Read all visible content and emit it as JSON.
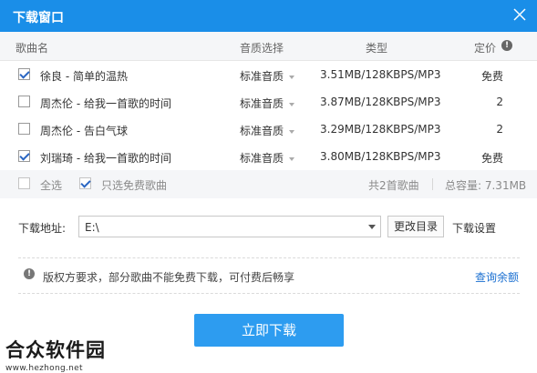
{
  "window": {
    "title": "下载窗口"
  },
  "table": {
    "headers": {
      "name": "歌曲名",
      "quality": "音质选择",
      "type": "类型",
      "price": "定价"
    },
    "rows": [
      {
        "checked": true,
        "name": "徐良 - 简单的温热",
        "quality": "标准音质",
        "type": "3.51MB/128KBPS/MP3",
        "price": "免费"
      },
      {
        "checked": false,
        "name": "周杰伦 - 给我一首歌的时间",
        "quality": "标准音质",
        "type": "3.87MB/128KBPS/MP3",
        "price": "2"
      },
      {
        "checked": false,
        "name": "周杰伦 - 告白气球",
        "quality": "标准音质",
        "type": "3.29MB/128KBPS/MP3",
        "price": "2"
      },
      {
        "checked": true,
        "name": "刘瑞琦 - 给我一首歌的时间",
        "quality": "标准音质",
        "type": "3.80MB/128KBPS/MP3",
        "price": "免费"
      }
    ]
  },
  "footer": {
    "select_all": "全选",
    "select_all_checked": false,
    "only_free": "只选免费歌曲",
    "only_free_checked": true,
    "count": "共2首歌曲",
    "capacity": "总容量: 7.31MB"
  },
  "address": {
    "label": "下载地址:",
    "value": "E:\\",
    "change_button": "更改目录",
    "settings": "下载设置"
  },
  "notice": {
    "text": "版权方要求，部分歌曲不能免费下载，可付费后畅享",
    "link": "查询余额"
  },
  "actions": {
    "download": "立即下载"
  },
  "watermark": {
    "title": "合众软件园",
    "url": "www.hezhong.net"
  },
  "colors": {
    "titlebar": "#1a8ee8",
    "primary_button": "#2d9cf0",
    "link": "#1a6fd1"
  },
  "icons": {
    "close": "close-icon",
    "info": "info-icon",
    "notice": "exclamation-icon"
  }
}
